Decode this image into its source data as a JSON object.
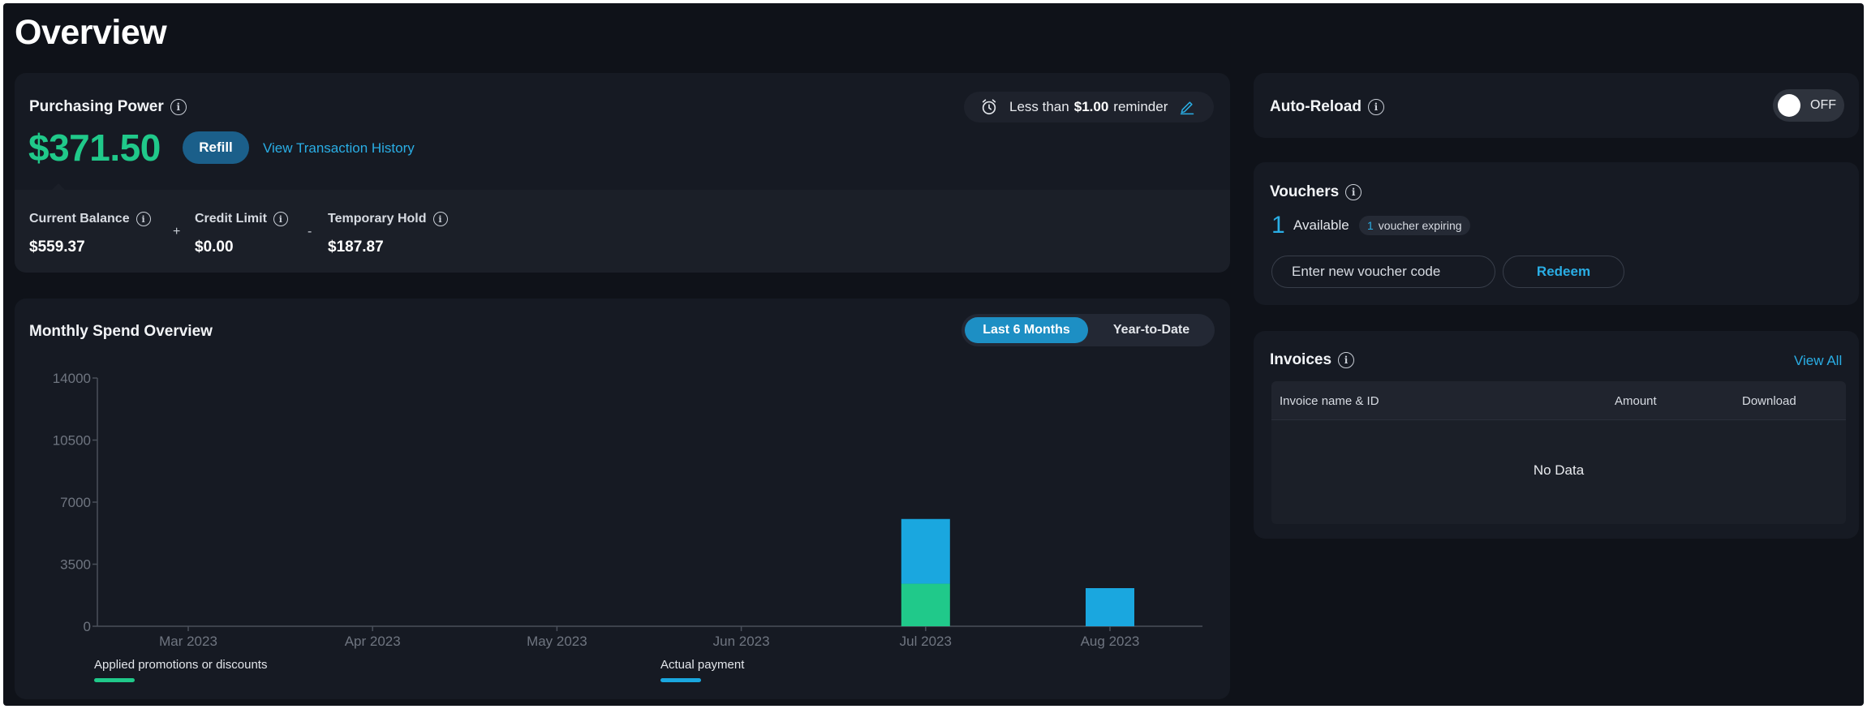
{
  "page_title": "Overview",
  "purchasing_power": {
    "title": "Purchasing Power",
    "amount": "$371.50",
    "refill_label": "Refill",
    "history_link": "View Transaction History",
    "reminder": {
      "prefix": "Less than",
      "amount": "$1.00",
      "suffix": "reminder",
      "icon": "alarm-clock-icon",
      "edit_icon": "pencil-icon"
    },
    "current_balance": {
      "label": "Current Balance",
      "value": "$559.37"
    },
    "op_plus": "+",
    "credit_limit": {
      "label": "Credit Limit",
      "value": "$0.00"
    },
    "op_minus": "-",
    "temporary_hold": {
      "label": "Temporary Hold",
      "value": "$187.87"
    }
  },
  "monthly_spend": {
    "title": "Monthly Spend Overview",
    "tab_active": "Last 6 Months",
    "tab_inactive": "Year-to-Date"
  },
  "auto_reload": {
    "title": "Auto-Reload",
    "state": "OFF"
  },
  "vouchers": {
    "title": "Vouchers",
    "count": "1",
    "available_label": "Available",
    "badge_count": "1",
    "badge_label": "voucher expiring",
    "input_placeholder": "Enter new voucher code",
    "redeem_label": "Redeem"
  },
  "invoices": {
    "title": "Invoices",
    "view_all": "View All",
    "columns": [
      "Invoice name & ID",
      "Amount",
      "Download"
    ],
    "empty_text": "No Data"
  },
  "colors": {
    "accent_green": "#20c98a",
    "accent_blue": "#1aa7df",
    "link_blue": "#2aaee5",
    "background": "#0f1219",
    "card": "#161a23"
  },
  "chart_data": {
    "type": "bar",
    "stacked": true,
    "categories": [
      "Mar 2023",
      "Apr 2023",
      "May 2023",
      "Jun 2023",
      "Jul 2023",
      "Aug 2023"
    ],
    "series": [
      {
        "name": "Applied promotions or discounts",
        "color": "#20c98a",
        "values": [
          0,
          0,
          0,
          0,
          2400,
          0
        ]
      },
      {
        "name": "Actual payment",
        "color": "#1aa7df",
        "values": [
          0,
          0,
          0,
          0,
          3650,
          2150
        ]
      }
    ],
    "yticks": [
      0,
      3500,
      7000,
      10500,
      14000
    ],
    "ylim": [
      0,
      14000
    ],
    "grid": false,
    "legend_position": "bottom"
  }
}
